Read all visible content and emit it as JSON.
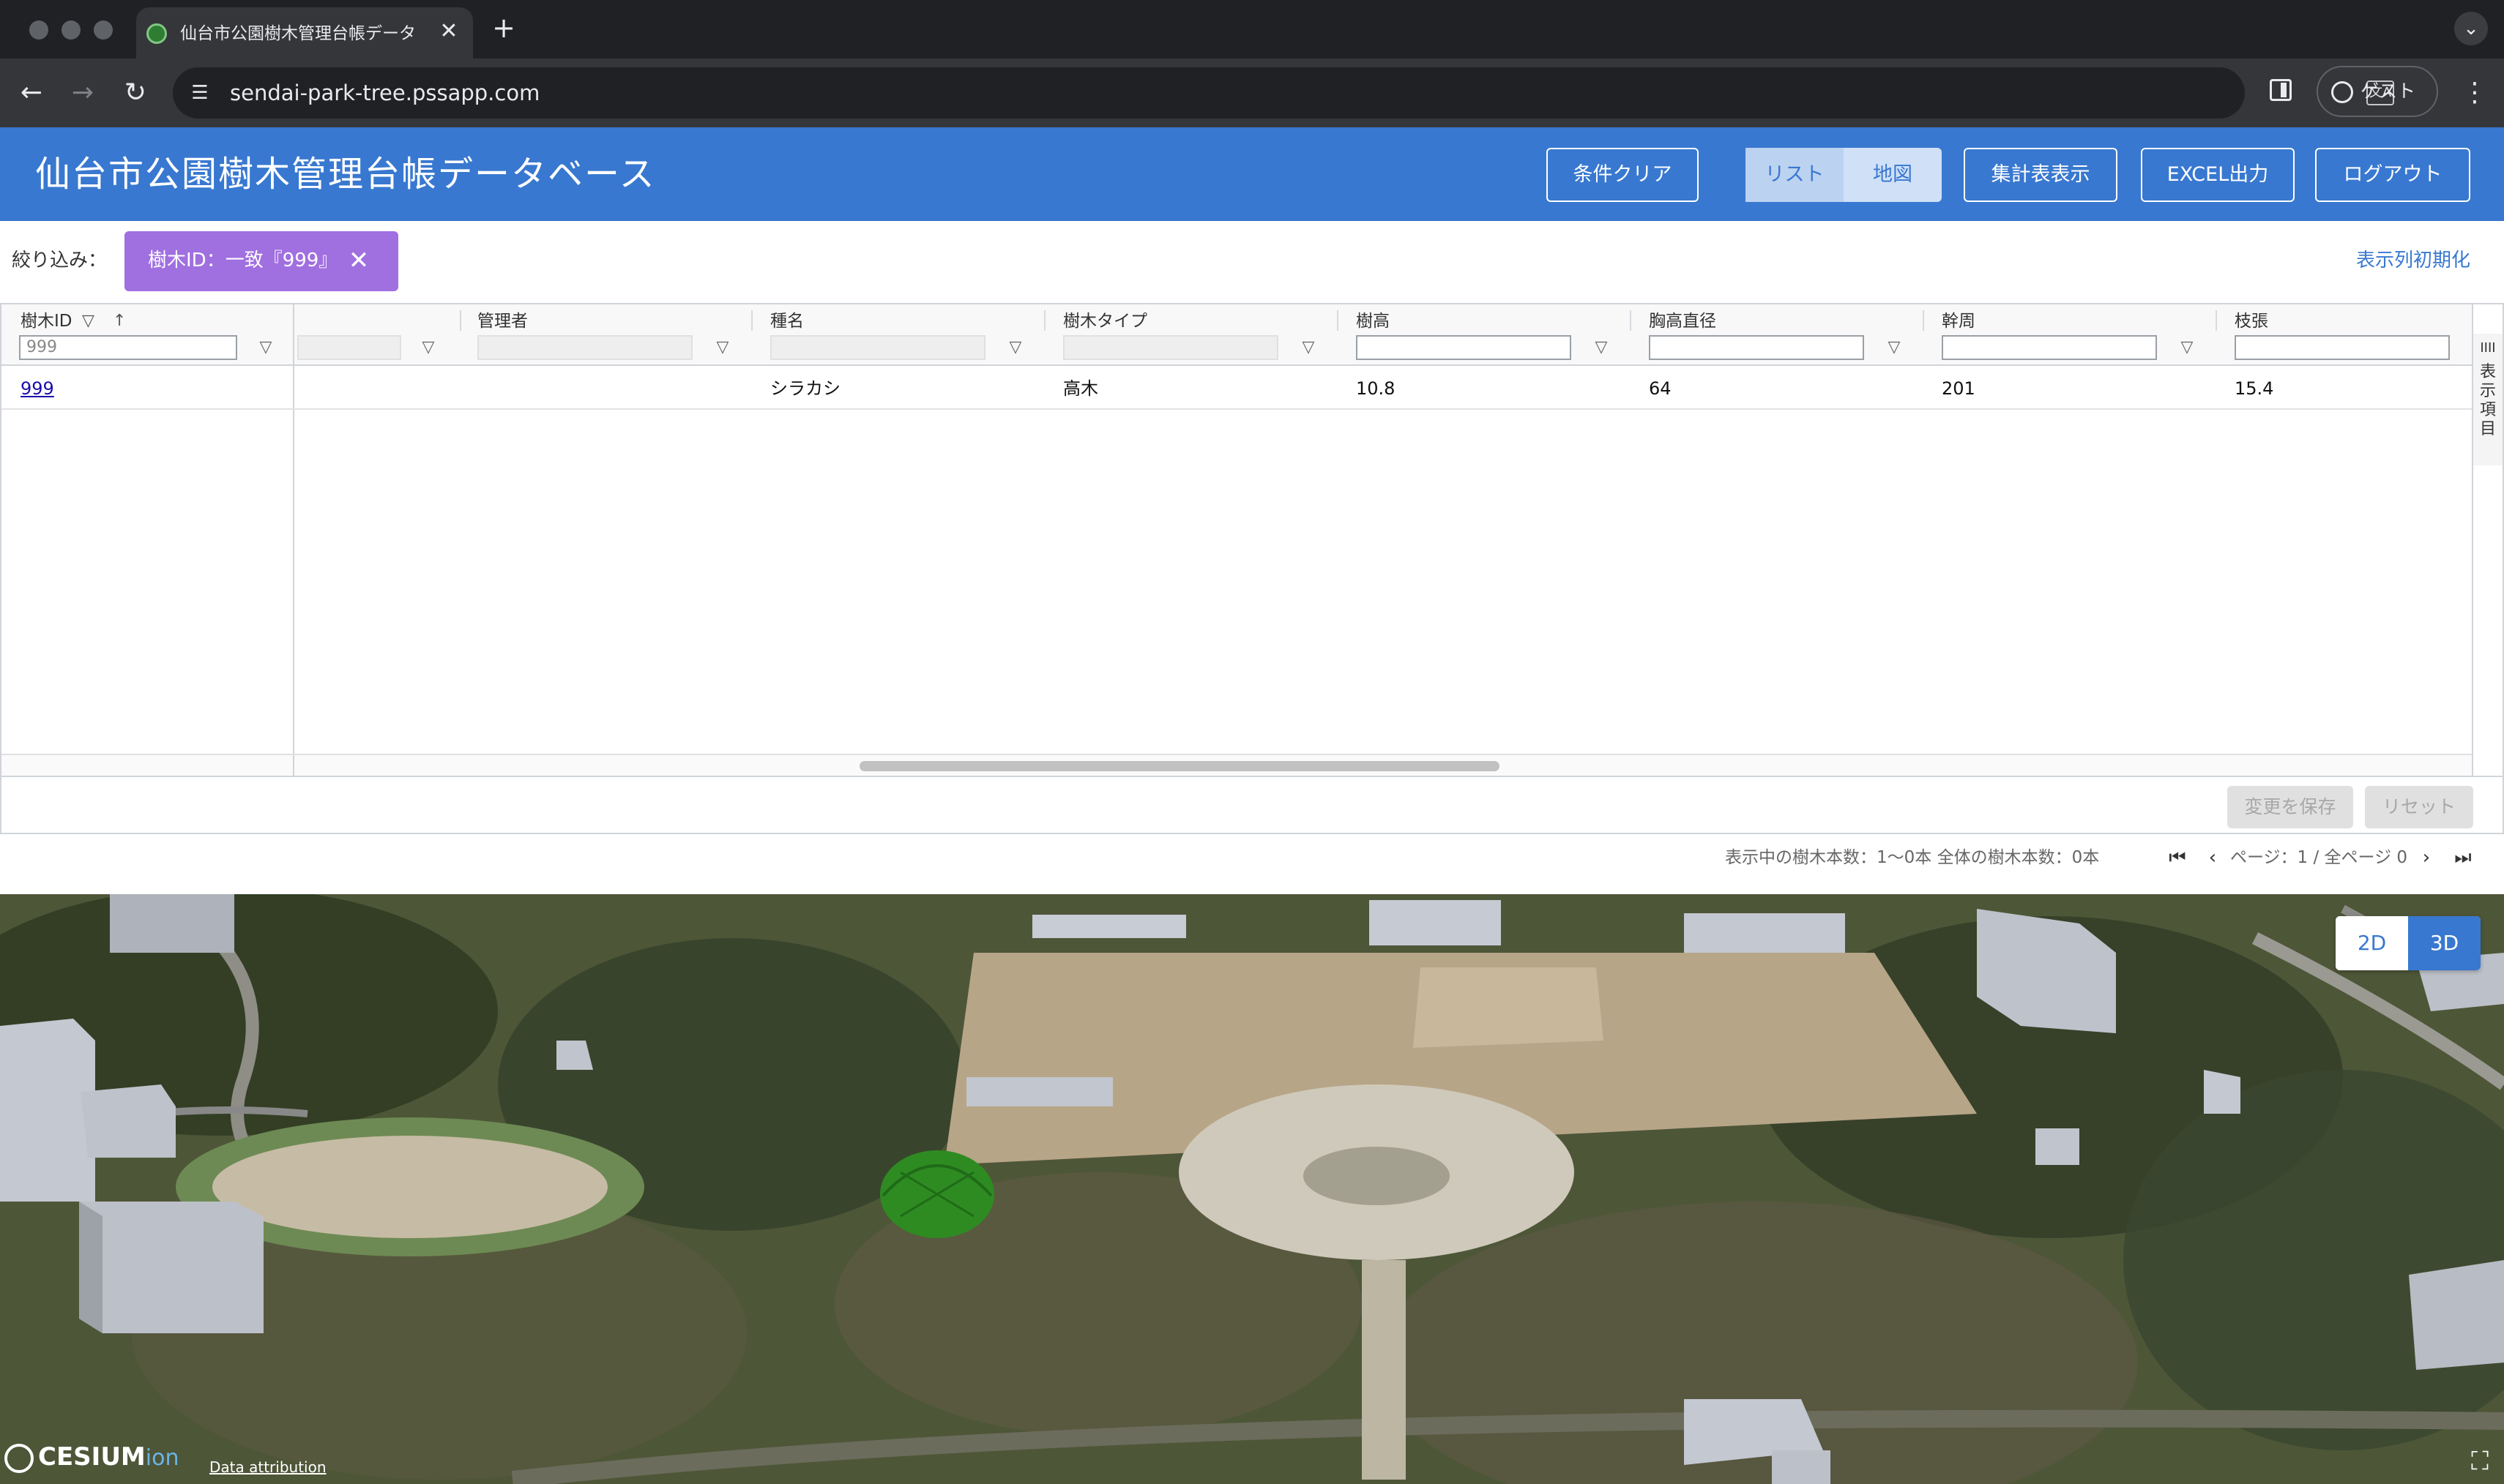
{
  "browser": {
    "tab_title": "仙台市公園樹木管理台帳データベース",
    "tab_close": "✕",
    "new_tab": "+",
    "tab_menu": "⌄",
    "back": "←",
    "forward": "→",
    "reload": "↻",
    "site_info_icon": "☰",
    "url": "sendai-park-tree.pssapp.com",
    "translate_icon": "文A",
    "profile_label": "ゲスト",
    "menu": "⋮"
  },
  "header": {
    "title": "仙台市公園樹木管理台帳データベース",
    "clear_button": "条件クリア",
    "list_button": "リスト",
    "map_button": "地図",
    "summary_button": "集計表表示",
    "excel_button": "EXCEL出力",
    "logout_button": "ログアウト"
  },
  "filter": {
    "label": "絞り込み：",
    "chip_text": "樹木ID：一致『999』",
    "chip_close": "✕",
    "reset_columns": "表示列初期化"
  },
  "grid": {
    "columns": [
      {
        "label": "樹木ID",
        "filter_value": "999"
      },
      {
        "label": "",
        "filter_value": ""
      },
      {
        "label": "管理者",
        "filter_value": ""
      },
      {
        "label": "種名",
        "filter_value": ""
      },
      {
        "label": "樹木タイプ",
        "filter_value": ""
      },
      {
        "label": "樹高",
        "filter_value": ""
      },
      {
        "label": "胸高直径",
        "filter_value": ""
      },
      {
        "label": "幹周",
        "filter_value": ""
      },
      {
        "label": "枝張",
        "filter_value": ""
      }
    ],
    "filter_icon": "▽",
    "sort_icon": "↑",
    "rows": [
      {
        "tree_id": "999",
        "col2": "",
        "manager": "",
        "species": "シラカシ",
        "tree_type": "高木",
        "height": "10.8",
        "dbh": "64",
        "girth": "201",
        "crown": "15.4"
      }
    ],
    "side_tab_icon": "IIII",
    "side_tab_label": "表示項目",
    "save_button": "変更を保存",
    "reset_button": "リセット"
  },
  "pager": {
    "info": "表示中の樹木本数：1〜0本 全体の樹木本数：0本",
    "first": "⏮",
    "prev": "‹",
    "page_text": "ページ：1 / 全ページ 0",
    "next": "›",
    "last": "⏭"
  },
  "map": {
    "mode_2d": "2D",
    "mode_3d": "3D",
    "cesium_text": "CESIUM",
    "cesium_ion": "ion",
    "attribution": "Data attribution",
    "fullscreen_icon": "⛶"
  },
  "colors": {
    "header_blue": "#3878d0",
    "chip_purple": "#a06fe0",
    "tree_green": "#2e8b22"
  }
}
